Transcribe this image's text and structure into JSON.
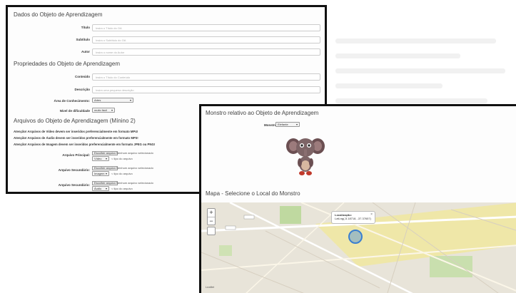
{
  "form": {
    "section1_title": "Dados do Objeto de Aprendizagem",
    "titulo_label": "Título",
    "titulo_placeholder": "Insira o Título do OA",
    "subtitulo_label": "Subtítulo",
    "subtitulo_placeholder": "Insira o Subtítulo do OA",
    "autor_label": "Autor",
    "autor_placeholder": "Insira o nome do Autor",
    "section2_title": "Propriedades do Objeto de Aprendizagem",
    "conteudo_label": "Conteúdo",
    "conteudo_placeholder": "Insira o Título do Conteúdo",
    "descricao_label": "Descrição",
    "descricao_placeholder": "Insira uma pequena descrição",
    "area_label": "Área de Conhecimento:",
    "area_value": "Artes",
    "nivel_label": "Nível de dificuldade",
    "nivel_value": "muito fácil",
    "section3_title": "Arquivos do Objeto de Aprendizagem (Mínino 2)",
    "warnings": [
      "Atenção! Arquivos de Vídeo devem ser inseridos preferencialmente em formato MP4!",
      "Atenção! Arquivos de Áudio devem ser inseridos preferencialmente em formato MP3!",
      "Atenção! Arquivos de Imagem devem ser inseridos preferencialmente em formato JPEG ou PNG!"
    ],
    "files": [
      {
        "label": "Arquivo Principal:",
        "button": "Escolher arquivo",
        "none": "Nenhum arquivo selecionado",
        "type": "Vídeo",
        "type_hint": "< tipo do arquivo"
      },
      {
        "label": "Arquivo Secundário:",
        "button": "Escolher arquivo",
        "none": "Nenhum arquivo selecionado",
        "type": "Imagem",
        "type_hint": "< tipo do arquivo"
      },
      {
        "label": "Arquivo Secundário:",
        "button": "Escolher arquivo",
        "none": "Nenhum arquivo selecionado",
        "type": "Áudio",
        "type_hint": "< tipo do arquivo"
      }
    ]
  },
  "monster": {
    "section_title": "Monstro relativo ao Objeto de Aprendizagem",
    "select_label": "Monstro",
    "select_value": "Elefante",
    "map_title": "Mapa - Selecione o Local do Monstro",
    "zoom_in": "+",
    "zoom_out": "−",
    "popup_title": "Localização:",
    "popup_coords": "LatLng(-5.18718, -37.37657)",
    "popup_close": "×",
    "map_credit": "Leaflet"
  }
}
